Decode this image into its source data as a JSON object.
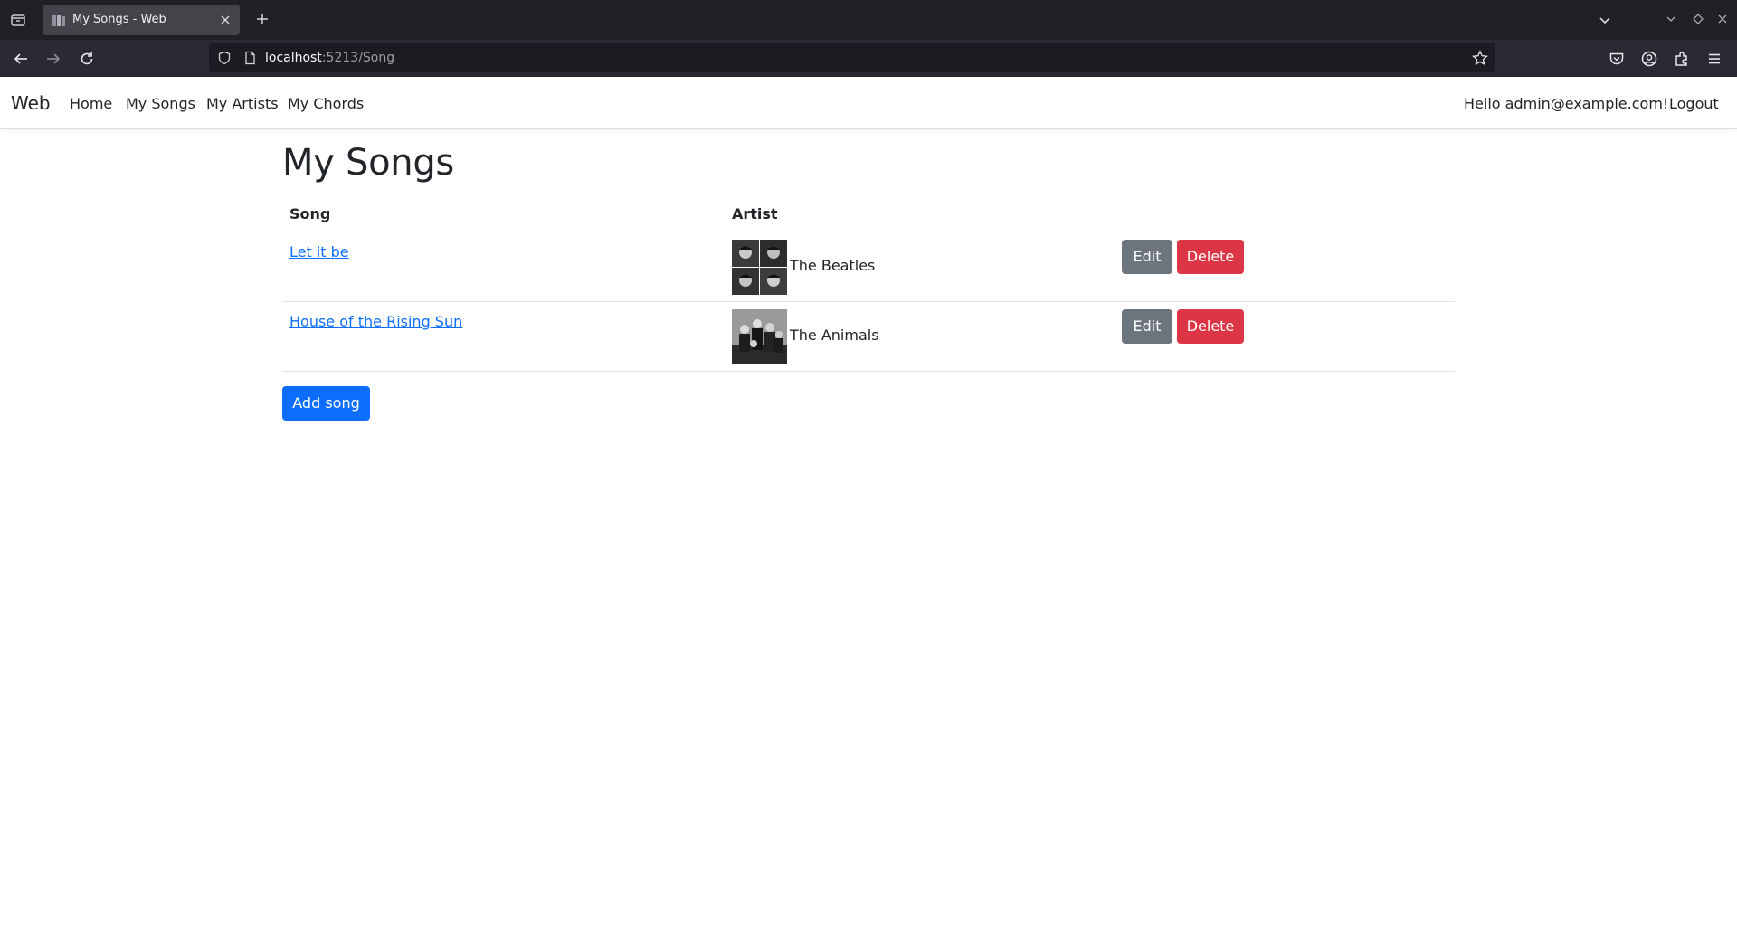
{
  "browser": {
    "tab": {
      "title": "My Songs - Web",
      "favicon": "page-icon"
    },
    "url": {
      "host": "localhost",
      "rest": ":5213/Song"
    }
  },
  "site": {
    "brand": "Web",
    "nav": [
      {
        "label": "Home"
      },
      {
        "label": "My Songs"
      },
      {
        "label": "My Artists"
      },
      {
        "label": "My Chords"
      }
    ],
    "greeting": "Hello admin@example.com!",
    "logout": "Logout"
  },
  "page": {
    "title": "My Songs",
    "table": {
      "headers": {
        "song": "Song",
        "artist": "Artist"
      },
      "rows": [
        {
          "song": "Let it be",
          "artist": "The Beatles",
          "edit": "Edit",
          "delete": "Delete"
        },
        {
          "song": "House of the Rising Sun",
          "artist": "The Animals",
          "edit": "Edit",
          "delete": "Delete"
        }
      ]
    },
    "add_button": "Add song"
  },
  "colors": {
    "primary": "#0d6efd",
    "secondary": "#6c757d",
    "danger": "#dc3545",
    "text": "#212529"
  }
}
